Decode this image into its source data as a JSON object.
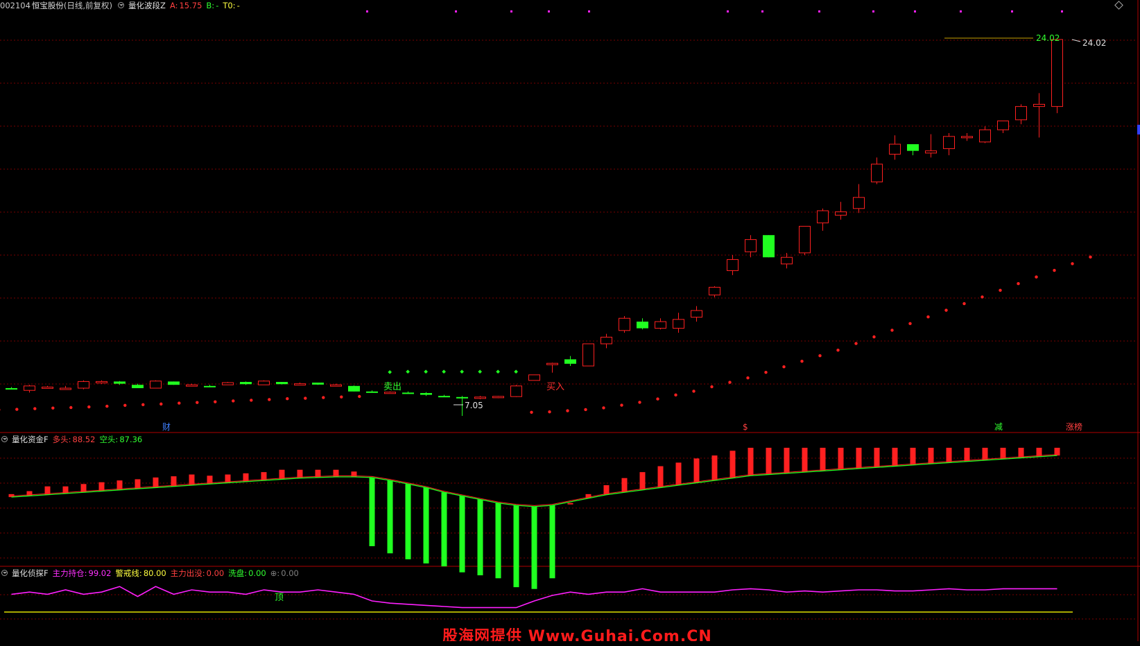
{
  "main_header": {
    "code": "002104",
    "name": "恒宝股份",
    "period": "(日线,前复权)",
    "indicator": "量化波段Z",
    "a_label": "A:",
    "a_value": "15.75",
    "b_label": "B:",
    "b_value": "-",
    "t0_label": "T0:",
    "t0_value": "-"
  },
  "panel_fund": {
    "title": "量化资金F",
    "long_label": "多头:",
    "long_value": "88.52",
    "short_label": "空头:",
    "short_value": "87.36"
  },
  "panel_detect": {
    "title": "量化侦探F",
    "holding_label": "主力持仓:",
    "holding_value": "99.02",
    "warn_label": "警戒线:",
    "warn_value": "80.00",
    "exit_label": "主力出没:",
    "exit_value": "0.00",
    "wash_label": "洗盘:",
    "wash_value": "0.00",
    "extra_label": "⊕:",
    "extra_value": "0.00"
  },
  "annotations": {
    "high_price": "24.02",
    "high_price_line": "24.02",
    "low_price": "7.05",
    "sell_signal": "卖出",
    "buy_signal": "买入",
    "top_signal": "顶",
    "event_cai": "财",
    "event_s": "$",
    "event_jian": "减",
    "event_zhangting": "涨榜"
  },
  "watermark": "股海网提供 Www.Guhai.Com.CN",
  "colors": {
    "background": "#000000",
    "up": "#ff2020",
    "down": "#20ff20",
    "grid": "#7a0000",
    "magenta": "#ff20ff",
    "yellow": "#e0e000"
  },
  "icons": {
    "dropdown": "circle-chevron-down-icon",
    "diamond": "diamond-icon"
  },
  "chart_data": {
    "type": "candlestick",
    "price_axis_labels_visible": false,
    "candles_ohlc": [
      [
        8.3,
        8.35,
        8.25,
        8.28
      ],
      [
        8.2,
        8.45,
        8.1,
        8.4
      ],
      [
        8.35,
        8.4,
        8.3,
        8.35
      ],
      [
        8.3,
        8.4,
        8.25,
        8.3
      ],
      [
        8.3,
        8.65,
        8.25,
        8.6
      ],
      [
        8.55,
        8.65,
        8.5,
        8.6
      ],
      [
        8.6,
        8.62,
        8.45,
        8.5
      ],
      [
        8.45,
        8.5,
        8.3,
        8.3
      ],
      [
        8.3,
        8.65,
        8.3,
        8.62
      ],
      [
        8.6,
        8.6,
        8.45,
        8.45
      ],
      [
        8.45,
        8.5,
        8.4,
        8.45
      ],
      [
        8.4,
        8.45,
        8.35,
        8.38
      ],
      [
        8.45,
        8.58,
        8.45,
        8.55
      ],
      [
        8.58,
        8.6,
        8.45,
        8.48
      ],
      [
        8.45,
        8.65,
        8.45,
        8.62
      ],
      [
        8.58,
        8.58,
        8.47,
        8.48
      ],
      [
        8.5,
        8.55,
        8.45,
        8.5
      ],
      [
        8.55,
        8.55,
        8.45,
        8.46
      ],
      [
        8.45,
        8.5,
        8.44,
        8.45
      ],
      [
        8.4,
        8.42,
        8.15,
        8.15
      ],
      [
        8.15,
        8.2,
        8.1,
        8.1
      ],
      [
        8.1,
        8.15,
        8.05,
        8.12
      ],
      [
        8.1,
        8.15,
        8.05,
        8.08
      ],
      [
        8.08,
        8.12,
        7.95,
        8.0
      ],
      [
        7.95,
        8.0,
        7.9,
        7.92
      ],
      [
        7.9,
        7.95,
        7.05,
        7.85
      ],
      [
        7.85,
        7.95,
        7.8,
        7.9
      ],
      [
        7.9,
        7.95,
        7.85,
        7.93
      ],
      [
        7.92,
        8.45,
        7.9,
        8.4
      ],
      [
        8.65,
        8.9,
        8.65,
        8.9
      ],
      [
        9.4,
        9.45,
        9.0,
        9.42
      ],
      [
        9.6,
        9.75,
        9.3,
        9.4
      ],
      [
        9.3,
        10.3,
        9.3,
        10.3
      ],
      [
        10.3,
        10.75,
        10.1,
        10.6
      ],
      [
        10.9,
        11.55,
        10.8,
        11.45
      ],
      [
        11.3,
        11.45,
        10.95,
        11.0
      ],
      [
        11.0,
        11.45,
        10.95,
        11.3
      ],
      [
        11.0,
        11.7,
        10.8,
        11.4
      ],
      [
        11.5,
        12.0,
        11.3,
        11.8
      ],
      [
        12.5,
        12.9,
        12.4,
        12.85
      ],
      [
        13.6,
        14.3,
        13.4,
        14.1
      ],
      [
        14.45,
        15.2,
        14.2,
        15.0
      ],
      [
        15.2,
        15.2,
        14.2,
        14.2
      ],
      [
        13.9,
        14.4,
        13.7,
        14.2
      ],
      [
        14.4,
        15.6,
        14.3,
        15.6
      ],
      [
        15.75,
        16.4,
        15.4,
        16.3
      ],
      [
        16.1,
        16.7,
        15.9,
        16.25
      ],
      [
        16.4,
        17.5,
        16.2,
        16.9
      ],
      [
        17.6,
        18.7,
        17.5,
        18.4
      ],
      [
        18.85,
        19.7,
        18.6,
        19.3
      ],
      [
        19.3,
        19.3,
        18.8,
        19.0
      ],
      [
        18.9,
        19.75,
        18.7,
        19.0
      ],
      [
        19.1,
        19.8,
        18.8,
        19.65
      ],
      [
        19.65,
        19.8,
        19.45,
        19.65
      ],
      [
        19.4,
        20.1,
        19.35,
        19.95
      ],
      [
        19.95,
        20.3,
        19.8,
        20.35
      ],
      [
        20.4,
        21.1,
        20.2,
        21.0
      ],
      [
        21.0,
        21.6,
        19.6,
        21.1
      ],
      [
        21.0,
        24.02,
        20.7,
        24.02
      ]
    ],
    "stop_dots_red_first": [
      8.2,
      8.22,
      8.25,
      8.28,
      8.3,
      8.33,
      8.36,
      8.4,
      8.43,
      8.46,
      8.5,
      8.53,
      8.56,
      8.6,
      8.63,
      8.66,
      8.7,
      8.72,
      8.75,
      8.78,
      8.8
    ],
    "stop_dots_green": [
      8.7,
      8.72,
      8.72,
      8.72,
      8.72,
      8.72,
      8.72,
      8.72
    ],
    "stop_dots_red_second": [
      8.4,
      8.42,
      8.47,
      8.52,
      8.6,
      8.72,
      8.85,
      9.0,
      9.18,
      9.35,
      9.55,
      9.75,
      9.95,
      10.2,
      10.45,
      10.7,
      10.95,
      11.2,
      11.5,
      11.8,
      12.1,
      12.4,
      12.7,
      13.0,
      13.3,
      13.6,
      13.9,
      14.2,
      14.5,
      14.8,
      15.1,
      15.4
    ],
    "fund_bars": [
      [
        1,
        55
      ],
      [
        1,
        60
      ],
      [
        1,
        68
      ],
      [
        1,
        68
      ],
      [
        1,
        72
      ],
      [
        1,
        75
      ],
      [
        1,
        78
      ],
      [
        1,
        80
      ],
      [
        1,
        83
      ],
      [
        1,
        85
      ],
      [
        1,
        88
      ],
      [
        1,
        86
      ],
      [
        1,
        88
      ],
      [
        1,
        90
      ],
      [
        1,
        92
      ],
      [
        1,
        96
      ],
      [
        1,
        96
      ],
      [
        1,
        96
      ],
      [
        1,
        96
      ],
      [
        1,
        93
      ],
      [
        0,
        84
      ],
      [
        0,
        72
      ],
      [
        0,
        62
      ],
      [
        0,
        55
      ],
      [
        0,
        50
      ],
      [
        0,
        40
      ],
      [
        0,
        35
      ],
      [
        0,
        30
      ],
      [
        0,
        15
      ],
      [
        0,
        12
      ],
      [
        0,
        30
      ],
      [
        1,
        40
      ],
      [
        1,
        55
      ],
      [
        1,
        70
      ],
      [
        1,
        82
      ],
      [
        1,
        92
      ],
      [
        1,
        102
      ],
      [
        1,
        108
      ],
      [
        1,
        115
      ],
      [
        1,
        120
      ],
      [
        1,
        128
      ],
      [
        1,
        133
      ],
      [
        1,
        133
      ],
      [
        1,
        133
      ],
      [
        1,
        133
      ],
      [
        1,
        133
      ],
      [
        1,
        133
      ],
      [
        1,
        133
      ],
      [
        1,
        133
      ],
      [
        1,
        133
      ],
      [
        1,
        133
      ],
      [
        1,
        133
      ],
      [
        1,
        133
      ],
      [
        1,
        133
      ],
      [
        1,
        133
      ],
      [
        1,
        133
      ],
      [
        1,
        133
      ],
      [
        1,
        133
      ],
      [
        1,
        133
      ]
    ],
    "fund_line": [
      50,
      52,
      54,
      56,
      58,
      60,
      62,
      64,
      66,
      68,
      70,
      72,
      74,
      76,
      78,
      80,
      82,
      83,
      84,
      84,
      83,
      78,
      72,
      66,
      58,
      52,
      46,
      40,
      36,
      34,
      36,
      42,
      48,
      54,
      58,
      62,
      66,
      70,
      74,
      78,
      82,
      86,
      88,
      90,
      92,
      94,
      96,
      98,
      100,
      102,
      104,
      106,
      108,
      110,
      112,
      114,
      116,
      118,
      120
    ],
    "holding_line": [
      96,
      98,
      96,
      100,
      96,
      98,
      103,
      94,
      103,
      96,
      100,
      98,
      98,
      96,
      100,
      98,
      98,
      100,
      98,
      96,
      90,
      88,
      87,
      86,
      85,
      84,
      84,
      84,
      84,
      90,
      95,
      98,
      96,
      98,
      98,
      101,
      98,
      98,
      98,
      98,
      100,
      101,
      100,
      98,
      99,
      98,
      99,
      100,
      100,
      99,
      99,
      100,
      101,
      100,
      100,
      101,
      101,
      101,
      101
    ],
    "warn_line": 80
  }
}
